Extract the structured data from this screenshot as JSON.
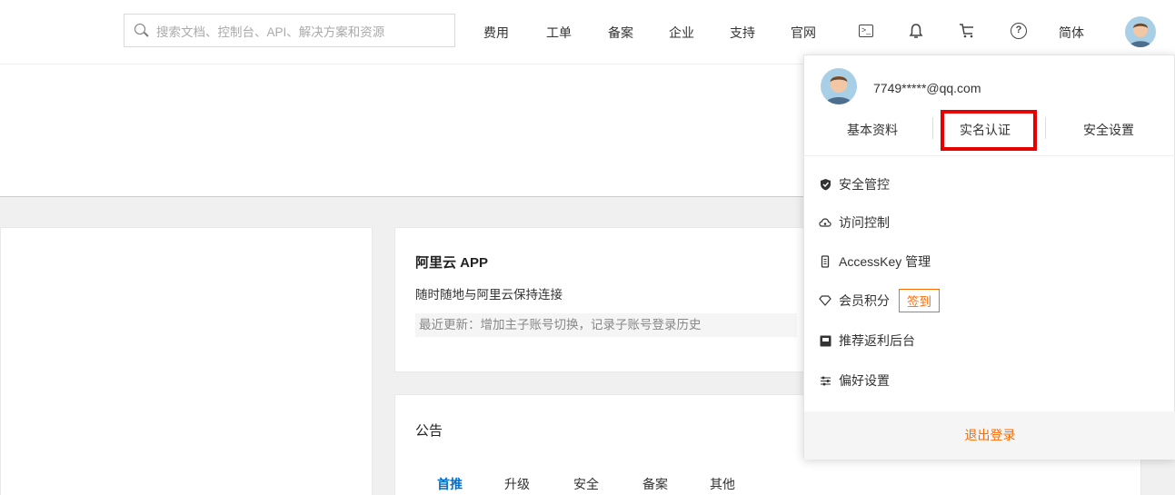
{
  "search": {
    "placeholder": "搜索文档、控制台、API、解决方案和资源"
  },
  "nav": {
    "items": [
      "费用",
      "工单",
      "备案",
      "企业",
      "支持",
      "官网"
    ],
    "lang": "简体",
    "icons": [
      "terminal-icon",
      "bell-icon",
      "cart-icon",
      "help-icon"
    ]
  },
  "account_menu": {
    "email": "7749*****@qq.com",
    "tabs": [
      "基本资料",
      "实名认证",
      "安全设置"
    ],
    "highlighted_tab": "实名认证",
    "highlight_color": "#e60000",
    "items": [
      {
        "label": "安全管控",
        "icon": "shield-icon"
      },
      {
        "label": "访问控制",
        "icon": "cloud-icon"
      },
      {
        "label": "AccessKey 管理",
        "icon": "key-icon"
      },
      {
        "label": "会员积分",
        "icon": "diamond-icon",
        "badge": "签到"
      },
      {
        "label": "推荐返利后台",
        "icon": "dashboard-icon"
      },
      {
        "label": "偏好设置",
        "icon": "sliders-icon"
      }
    ],
    "logout": "退出登录",
    "accent": "#ff6a00"
  },
  "app_card": {
    "title": "阿里云 APP",
    "subtitle": "随时随地与阿里云保持连接",
    "update": "最近更新：增加主子账号切换，记录子账号登录历史"
  },
  "notice_card": {
    "title": "公告",
    "tabs": [
      "首推",
      "升级",
      "安全",
      "备案",
      "其他"
    ],
    "active_tab": "首推",
    "active_color": "#0070cc"
  }
}
